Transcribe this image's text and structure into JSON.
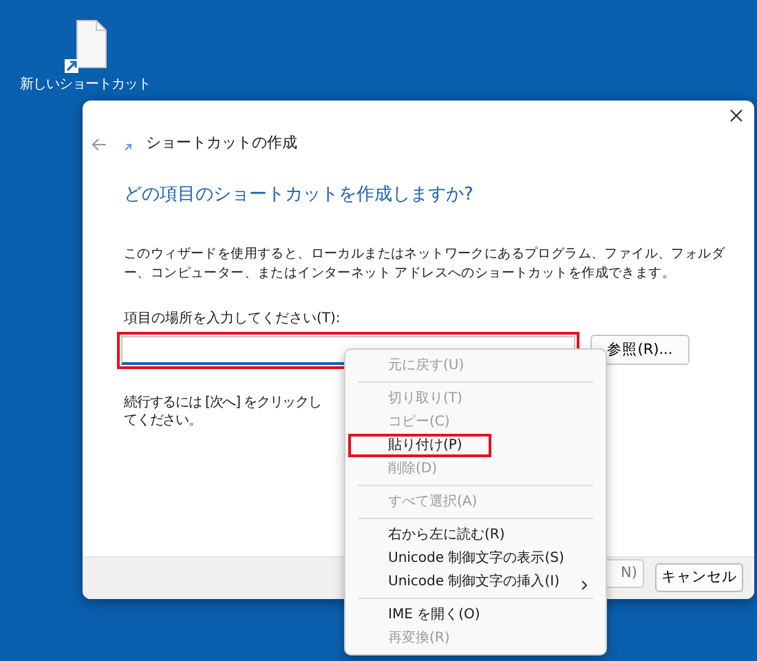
{
  "desktop": {
    "icons": [
      {
        "label": "新しいショートカット"
      }
    ]
  },
  "dialog": {
    "title": "ショートカットの作成",
    "heading": "どの項目のショートカットを作成しますか?",
    "description": "このウィザードを使用すると、ローカルまたはネットワークにあるプログラム、ファイル、フォルダー、コンピューター、またはインターネット アドレスへのショートカットを作成できます。",
    "field_label": "項目の場所を入力してください(T):",
    "field": {
      "highlighted": true
    },
    "browse_button": "参照(R)...",
    "hint": "続行するには [次へ] をクリックしてください。",
    "buttons": [
      {
        "kind": "next",
        "label": "N)"
      },
      {
        "kind": "cancel",
        "label": "キャンセル"
      }
    ]
  },
  "context_menu": {
    "items": [
      {
        "kind": "item",
        "label": "元に戻す(U)",
        "disabled": true,
        "highlighted": false
      },
      {
        "kind": "separator"
      },
      {
        "kind": "item",
        "label": "切り取り(T)",
        "disabled": true,
        "highlighted": false
      },
      {
        "kind": "item",
        "label": "コピー(C)",
        "disabled": true,
        "highlighted": false
      },
      {
        "kind": "item",
        "label": "貼り付け(P)",
        "disabled": false,
        "highlighted": true
      },
      {
        "kind": "item",
        "label": "削除(D)",
        "disabled": true,
        "highlighted": false
      },
      {
        "kind": "separator"
      },
      {
        "kind": "item",
        "label": "すべて選択(A)",
        "disabled": true,
        "highlighted": false
      },
      {
        "kind": "separator"
      },
      {
        "kind": "item",
        "label": "右から左に読む(R)",
        "disabled": false,
        "highlighted": false
      },
      {
        "kind": "item",
        "label": "Unicode 制御文字の表示(S)",
        "disabled": false,
        "highlighted": false
      },
      {
        "kind": "submenu",
        "label": "Unicode 制御文字の挿入(I)",
        "disabled": false,
        "highlighted": false
      },
      {
        "kind": "separator"
      },
      {
        "kind": "item",
        "label": "IME を開く(O)",
        "disabled": false,
        "highlighted": false
      },
      {
        "kind": "item",
        "label": "再変換(R)",
        "disabled": true,
        "highlighted": false
      }
    ]
  }
}
